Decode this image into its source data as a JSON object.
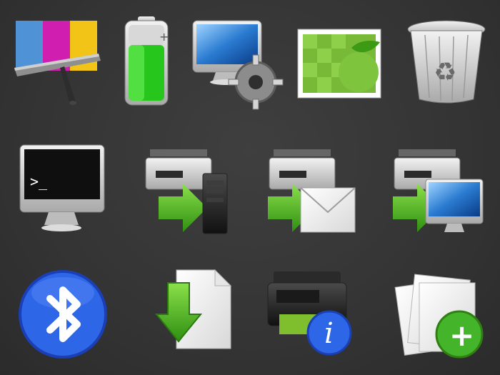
{
  "icons": [
    {
      "name": "color-calibration-icon"
    },
    {
      "name": "battery-icon"
    },
    {
      "name": "computer-settings-icon"
    },
    {
      "name": "image-icon"
    },
    {
      "name": "trash-icon"
    },
    {
      "name": "terminal-icon",
      "prompt": ">_"
    },
    {
      "name": "scan-to-server-icon"
    },
    {
      "name": "scan-to-email-icon"
    },
    {
      "name": "scan-to-computer-icon"
    },
    {
      "name": "bluetooth-icon"
    },
    {
      "name": "download-file-icon"
    },
    {
      "name": "printer-info-icon",
      "glyph": "i"
    },
    {
      "name": "add-document-icon",
      "glyph": "+"
    }
  ]
}
